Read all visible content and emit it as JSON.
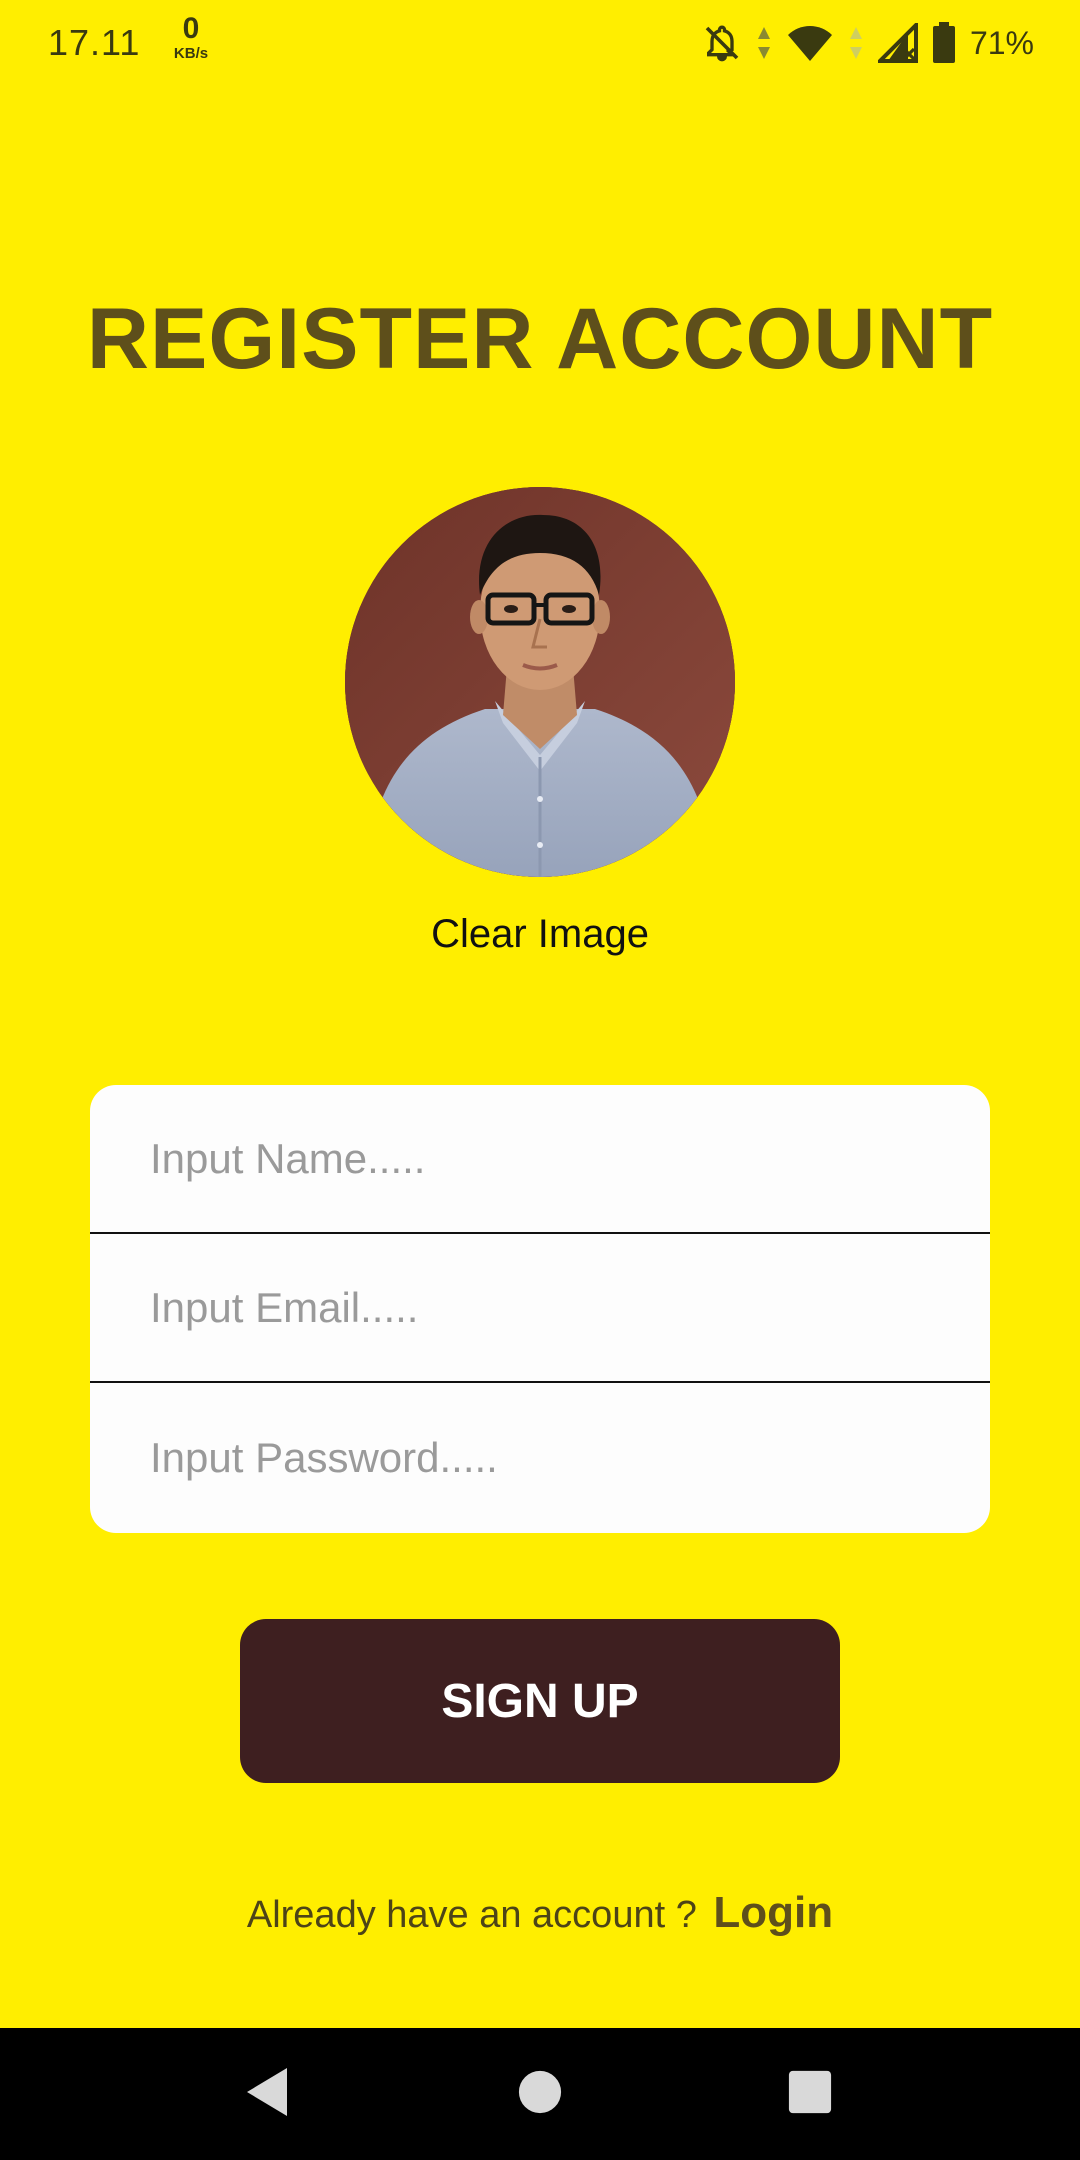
{
  "status_bar": {
    "time": "17.11",
    "net_speed_value": "0",
    "net_speed_unit": "KB/s",
    "battery_percent": "71%",
    "icons": [
      "bell-off-icon",
      "data-arrows-icon",
      "wifi-icon",
      "signal-icon",
      "battery-icon"
    ]
  },
  "header": {
    "title": "REGISTER ACCOUNT"
  },
  "avatar": {
    "clear_label": "Clear Image"
  },
  "form": {
    "name_placeholder": "Input Name.....",
    "email_placeholder": "Input Email.....",
    "password_placeholder": "Input Password....."
  },
  "actions": {
    "signup_label": "SIGN UP"
  },
  "footer": {
    "prompt": "Already have an account ?",
    "login_label": "Login"
  },
  "nav": {
    "icons": [
      "back-icon",
      "home-icon",
      "recents-icon"
    ]
  },
  "colors": {
    "background": "#FFEE00",
    "title": "#5E4F1B",
    "button": "#3E1F20",
    "card": "#FDFDFD",
    "nav_bar": "#000000"
  }
}
